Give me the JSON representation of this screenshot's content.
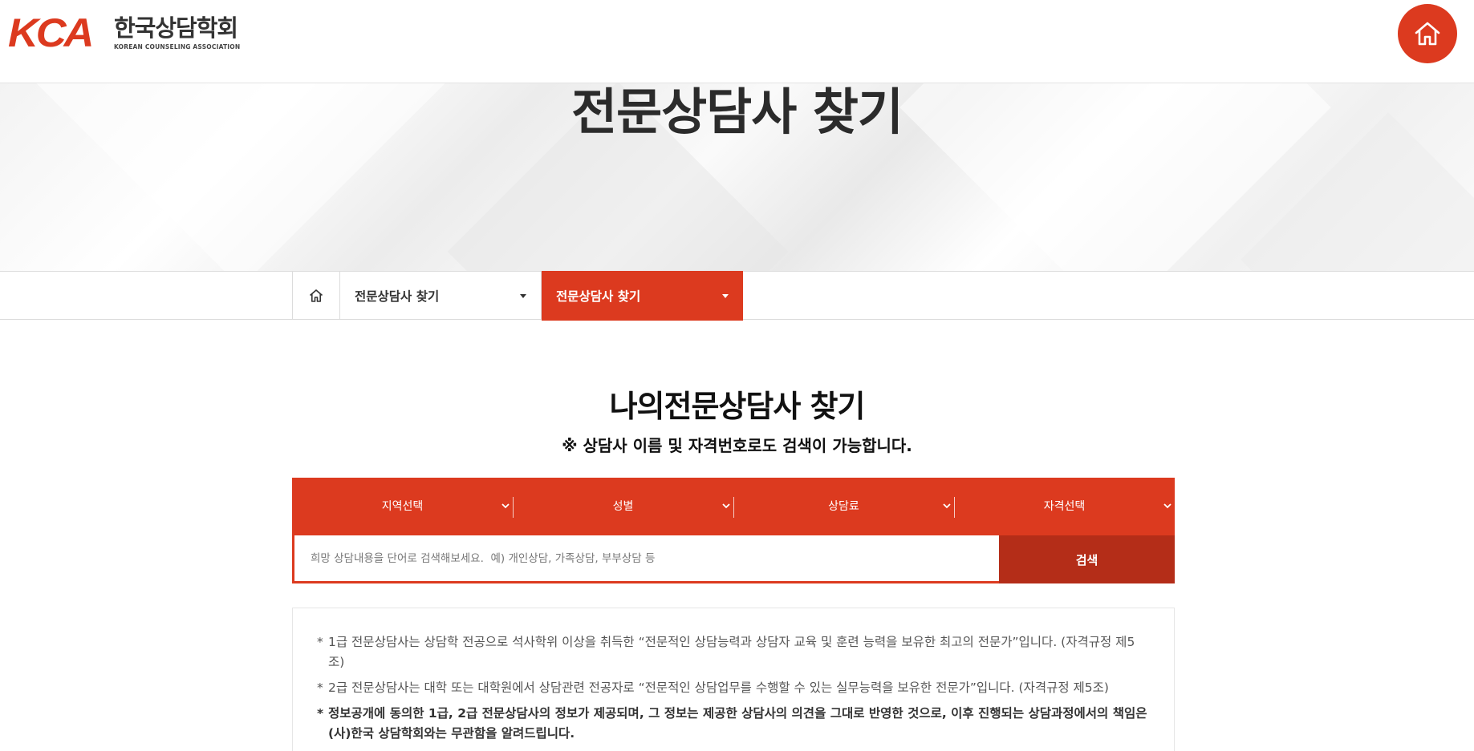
{
  "header": {
    "logo_mark": "KCA",
    "logo_kr": "한국상담학회",
    "logo_en": "KOREAN COUNSELING ASSOCIATION",
    "home_icon": "home-icon"
  },
  "hero": {
    "title": "전문상담사 찾기"
  },
  "breadcrumb": {
    "home_icon": "home-icon",
    "item1": "전문상담사 찾기",
    "item2": "전문상담사 찾기"
  },
  "section": {
    "title": "나의전문상담사 찾기",
    "subtitle": "※ 상담사 이름 및 자격번호로도 검색이 가능합니다."
  },
  "search": {
    "filters": [
      "지역선택",
      "성별",
      "상담료",
      "자격선택"
    ],
    "placeholder": "희망 상담내용을 단어로 검색해보세요.  예) 개인상담, 가족상담, 부부상담 등",
    "value": "",
    "button": "검색"
  },
  "notes": [
    {
      "marker": "*",
      "text": "1급 전문상담사는 상담학 전공으로 석사학위 이상을 취득한 “전문적인 상담능력과 상담자 교육 및 훈련 능력을 보유한 최고의 전문가”입니다. (자격규정 제5조)",
      "bold": false
    },
    {
      "marker": "*",
      "text": "2급 전문상담사는 대학 또는 대학원에서 상담관련 전공자로 “전문적인 상담업무를 수행할 수 있는 실무능력을 보유한 전문가”입니다. (자격규정 제5조)",
      "bold": false
    },
    {
      "marker": "*",
      "text": "정보공개에 동의한 1급, 2급 전문상담사의 정보가 제공되며, 그 정보는 제공한 상담사의 의견을 그대로 반영한 것으로, 이후 진행되는 상담과정에서의 책임은 (사)한국 상담학회와는 무관함을 알려드립니다.",
      "bold": true
    }
  ],
  "colors": {
    "accent": "#dc3a1f",
    "accent_dark": "#b42d18"
  }
}
